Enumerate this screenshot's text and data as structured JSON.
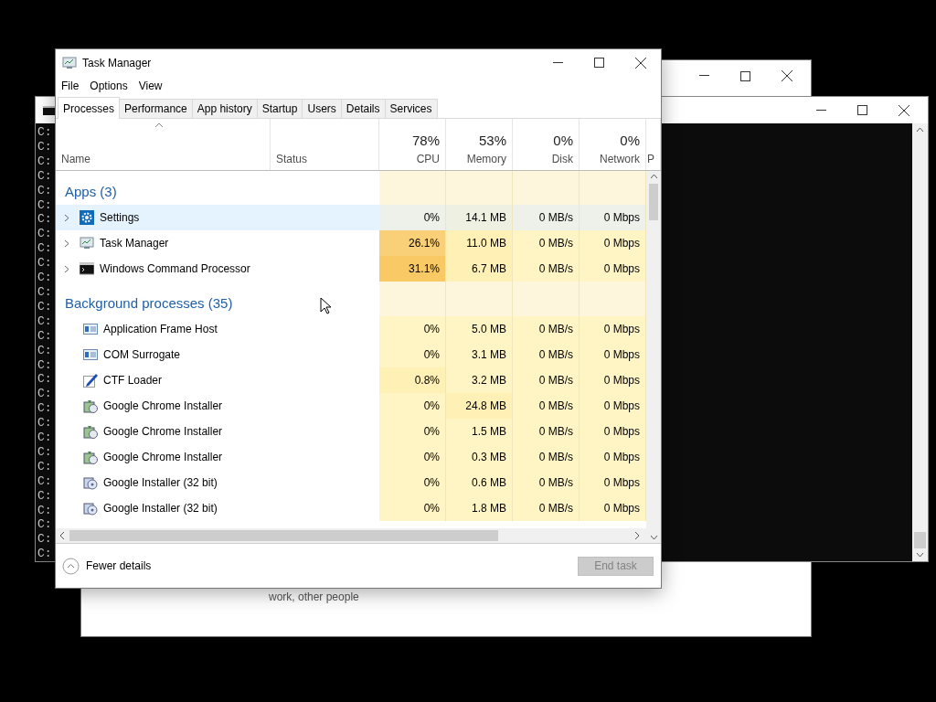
{
  "back_window": {
    "footer_text": "work, other people"
  },
  "console": {
    "lines": [
      "C:",
      "C:",
      "C:",
      "C:",
      "C:",
      "C:",
      "C:",
      "C:",
      "C:",
      "C:",
      "C:",
      "C:",
      "C:",
      "C:",
      "C:",
      "C:",
      "C:",
      "C:",
      "C:",
      "C:",
      "C:",
      "C:",
      "C:",
      "C:",
      "C:",
      "C:",
      "C:",
      "C:",
      "C:",
      "C:"
    ]
  },
  "task_manager": {
    "title": "Task Manager",
    "menu": [
      "File",
      "Options",
      "View"
    ],
    "tabs": [
      {
        "label": "Processes",
        "selected": true
      },
      {
        "label": "Performance",
        "selected": false
      },
      {
        "label": "App history",
        "selected": false
      },
      {
        "label": "Startup",
        "selected": false
      },
      {
        "label": "Users",
        "selected": false
      },
      {
        "label": "Details",
        "selected": false
      },
      {
        "label": "Services",
        "selected": false
      }
    ],
    "columns": [
      {
        "label": "Name"
      },
      {
        "label": "Status"
      },
      {
        "usage": "78%",
        "label": "CPU"
      },
      {
        "usage": "53%",
        "label": "Memory"
      },
      {
        "usage": "0%",
        "label": "Disk"
      },
      {
        "usage": "0%",
        "label": "Network"
      },
      {
        "label": "P"
      }
    ],
    "rows": [
      {
        "kind": "group",
        "label": "Apps (3)"
      },
      {
        "kind": "process",
        "name": "Settings",
        "expandable": true,
        "selected": true,
        "cells": [
          {
            "text": "0%",
            "color": "#eef1e9"
          },
          {
            "text": "14.1 MB",
            "color": "#eef1e2"
          },
          {
            "text": "0 MB/s",
            "color": "#eef1e9"
          },
          {
            "text": "0 Mbps",
            "color": "#eef1e9"
          }
        ]
      },
      {
        "kind": "process",
        "name": "Task Manager",
        "expandable": true,
        "selected": false,
        "cells": [
          {
            "text": "26.1%",
            "color": "#f9cf78"
          },
          {
            "text": "11.0 MB",
            "color": "#fff0b6"
          },
          {
            "text": "0 MB/s",
            "color": "#fff4c4"
          },
          {
            "text": "0 Mbps",
            "color": "#fff4c4"
          }
        ]
      },
      {
        "kind": "process",
        "name": "Windows Command Processor",
        "expandable": true,
        "selected": false,
        "cells": [
          {
            "text": "31.1%",
            "color": "#f8c965"
          },
          {
            "text": "6.7 MB",
            "color": "#fff0b6"
          },
          {
            "text": "0 MB/s",
            "color": "#fff4c4"
          },
          {
            "text": "0 Mbps",
            "color": "#fff4c4"
          }
        ]
      },
      {
        "kind": "group",
        "label": "Background processes (35)"
      },
      {
        "kind": "process",
        "name": "Application Frame Host",
        "expandable": false,
        "selected": false,
        "cells": [
          {
            "text": "0%",
            "color": "#fff4c4"
          },
          {
            "text": "5.0 MB",
            "color": "#fff4c4"
          },
          {
            "text": "0 MB/s",
            "color": "#fff4c4"
          },
          {
            "text": "0 Mbps",
            "color": "#fff4c4"
          }
        ]
      },
      {
        "kind": "process",
        "name": "COM Surrogate",
        "expandable": false,
        "selected": false,
        "cells": [
          {
            "text": "0%",
            "color": "#fff4c4"
          },
          {
            "text": "3.1 MB",
            "color": "#fff4c4"
          },
          {
            "text": "0 MB/s",
            "color": "#fff4c4"
          },
          {
            "text": "0 Mbps",
            "color": "#fff4c4"
          }
        ]
      },
      {
        "kind": "process",
        "name": "CTF Loader",
        "expandable": false,
        "selected": false,
        "cells": [
          {
            "text": "0.8%",
            "color": "#fff0b6"
          },
          {
            "text": "3.2 MB",
            "color": "#fff4c4"
          },
          {
            "text": "0 MB/s",
            "color": "#fff4c4"
          },
          {
            "text": "0 Mbps",
            "color": "#fff4c4"
          }
        ]
      },
      {
        "kind": "process",
        "name": "Google Chrome Installer",
        "expandable": false,
        "selected": false,
        "cells": [
          {
            "text": "0%",
            "color": "#fff4c4"
          },
          {
            "text": "24.8 MB",
            "color": "#fff0b6"
          },
          {
            "text": "0 MB/s",
            "color": "#fff4c4"
          },
          {
            "text": "0 Mbps",
            "color": "#fff4c4"
          }
        ]
      },
      {
        "kind": "process",
        "name": "Google Chrome Installer",
        "expandable": false,
        "selected": false,
        "cells": [
          {
            "text": "0%",
            "color": "#fff4c4"
          },
          {
            "text": "1.5 MB",
            "color": "#fff4c4"
          },
          {
            "text": "0 MB/s",
            "color": "#fff4c4"
          },
          {
            "text": "0 Mbps",
            "color": "#fff4c4"
          }
        ]
      },
      {
        "kind": "process",
        "name": "Google Chrome Installer",
        "expandable": false,
        "selected": false,
        "cells": [
          {
            "text": "0%",
            "color": "#fff4c4"
          },
          {
            "text": "0.3 MB",
            "color": "#fff4c4"
          },
          {
            "text": "0 MB/s",
            "color": "#fff4c4"
          },
          {
            "text": "0 Mbps",
            "color": "#fff4c4"
          }
        ]
      },
      {
        "kind": "process",
        "name": "Google Installer (32 bit)",
        "expandable": false,
        "selected": false,
        "cells": [
          {
            "text": "0%",
            "color": "#fff4c4"
          },
          {
            "text": "0.6 MB",
            "color": "#fff4c4"
          },
          {
            "text": "0 MB/s",
            "color": "#fff4c4"
          },
          {
            "text": "0 Mbps",
            "color": "#fff4c4"
          }
        ]
      },
      {
        "kind": "process",
        "name": "Google Installer (32 bit)",
        "expandable": false,
        "selected": false,
        "cells": [
          {
            "text": "0%",
            "color": "#fff4c4"
          },
          {
            "text": "1.8 MB",
            "color": "#fff4c4"
          },
          {
            "text": "0 MB/s",
            "color": "#fff4c4"
          },
          {
            "text": "0 Mbps",
            "color": "#fff4c4"
          }
        ]
      }
    ],
    "footer": {
      "details": "Fewer details",
      "end_task": "End task",
      "end_task_disabled": true
    }
  }
}
